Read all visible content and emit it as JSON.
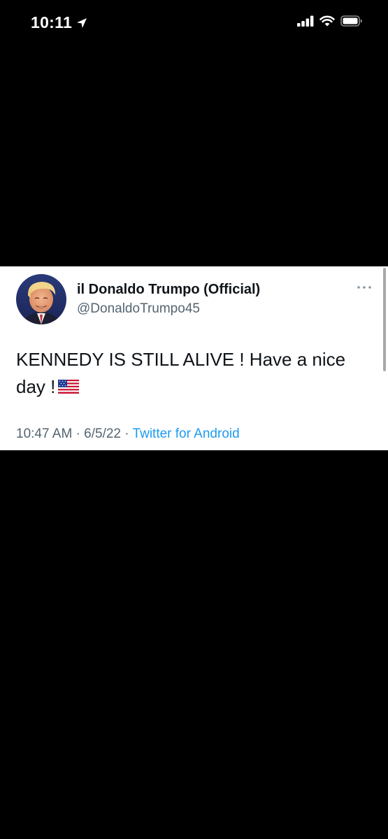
{
  "status_bar": {
    "time": "10:11",
    "icons": [
      "location-arrow-icon",
      "cellular-signal-icon",
      "wifi-icon",
      "battery-icon"
    ]
  },
  "tweet": {
    "display_name": "il Donaldo Trumpo (Official)",
    "handle": "@DonaldoTrumpo45",
    "text": "KENNEDY IS STILL ALIVE ! Have a nice day !",
    "emoji": "us-flag-emoji",
    "time": "10:47 AM",
    "separator": "·",
    "date": "6/5/22",
    "source": "Twitter for Android",
    "more_icon": "more-options-icon",
    "colors": {
      "source_link": "#1d9bf0",
      "secondary_text": "#536471",
      "primary_text": "#0f1419"
    }
  }
}
